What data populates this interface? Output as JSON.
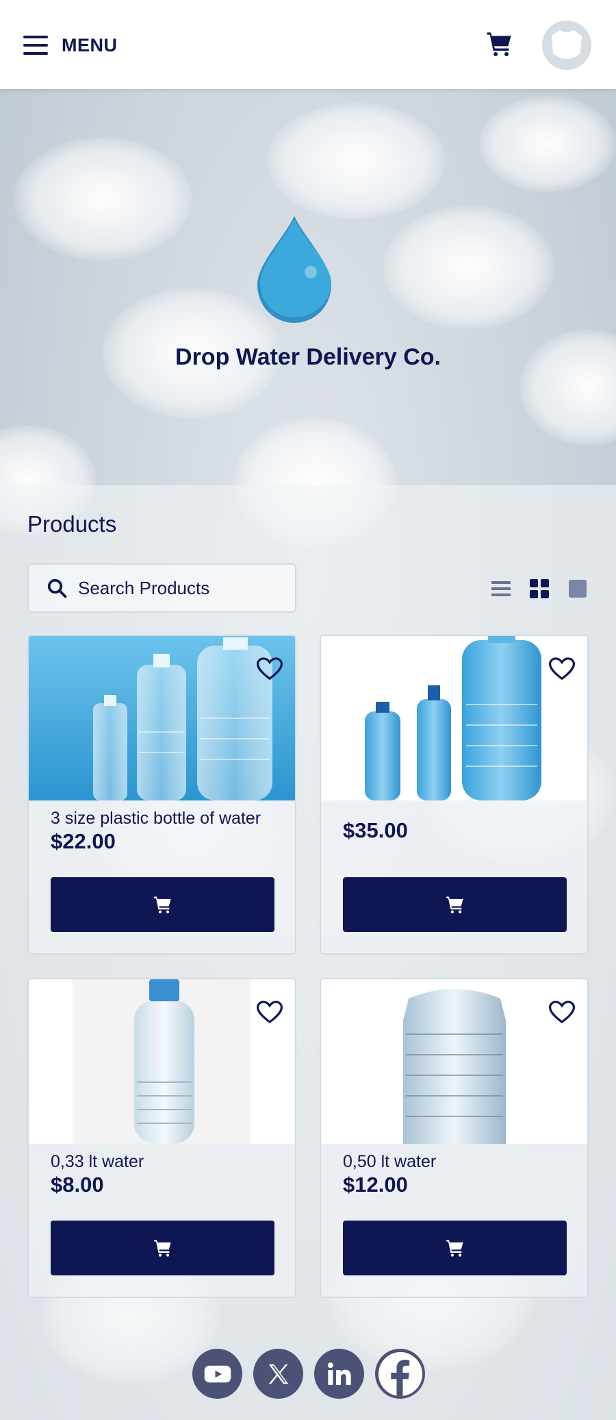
{
  "header": {
    "menu_label": "MENU"
  },
  "hero": {
    "company_name": "Drop Water Delivery Co."
  },
  "products": {
    "title": "Products",
    "search_placeholder": "Search Products",
    "view_modes": [
      "list-view-icon",
      "grid-view-icon",
      "large-view-icon"
    ],
    "items": [
      {
        "name": "3 size plastic bottle of water",
        "price": "$22.00"
      },
      {
        "name": "",
        "price": "$35.00"
      },
      {
        "name": "0,33 lt water",
        "price": "$8.00"
      },
      {
        "name": "0,50 lt water",
        "price": "$12.00"
      }
    ]
  },
  "social": [
    "youtube-icon",
    "x-icon",
    "linkedin-icon",
    "facebook-icon"
  ],
  "colors": {
    "primary": "#0f1654",
    "accent_water": "#3ba9dc",
    "social_bg": "#4c5276"
  }
}
